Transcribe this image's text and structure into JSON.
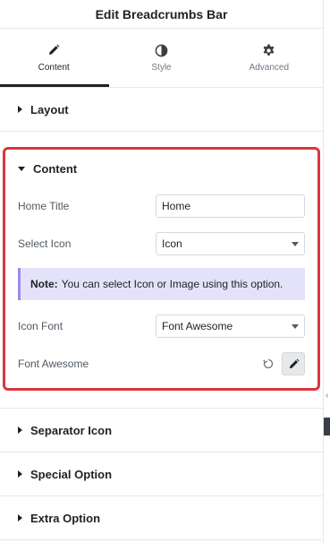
{
  "header": {
    "title": "Edit Breadcrumbs Bar"
  },
  "tabs": [
    {
      "label": "Content",
      "icon": "pencil-icon",
      "active": true
    },
    {
      "label": "Style",
      "icon": "half-circle-icon",
      "active": false
    },
    {
      "label": "Advanced",
      "icon": "gear-icon",
      "active": false
    }
  ],
  "sections": {
    "layout": {
      "label": "Layout"
    },
    "content": {
      "label": "Content"
    },
    "separator": {
      "label": "Separator Icon"
    },
    "special": {
      "label": "Special Option"
    },
    "extra": {
      "label": "Extra Option"
    }
  },
  "content_fields": {
    "home_title": {
      "label": "Home Title",
      "value": "Home"
    },
    "select_icon": {
      "label": "Select Icon",
      "value": "Icon"
    },
    "note": {
      "bold": "Note:",
      "text": "You can select Icon or Image using this option."
    },
    "icon_font": {
      "label": "Icon Font",
      "value": "Font Awesome"
    },
    "font_awesome": {
      "label": "Font Awesome"
    }
  },
  "colors": {
    "highlight_border": "#d9363e",
    "note_bg": "#e4e2fb",
    "note_accent": "#9b8ae8"
  }
}
